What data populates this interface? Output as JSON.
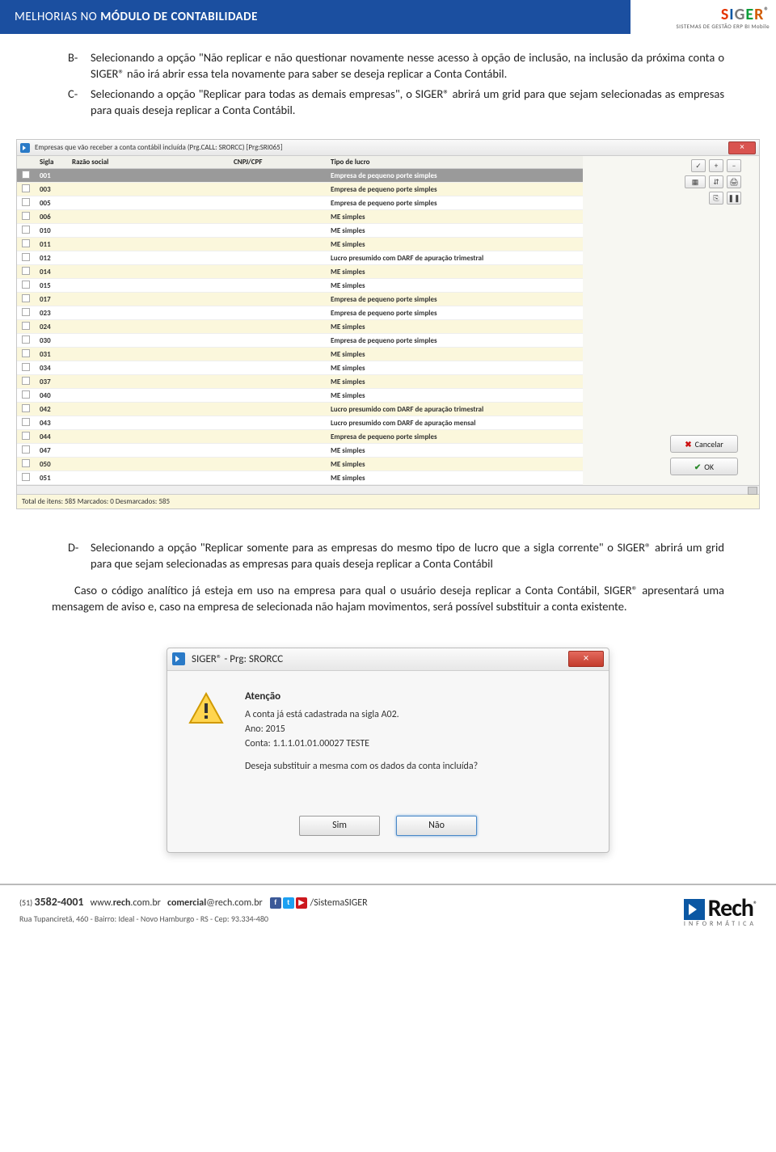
{
  "header": {
    "title_prefix": "MELHORIAS NO ",
    "title_bold": "MÓDULO DE CONTABILIDADE",
    "logo_letters": [
      "S",
      "I",
      "G",
      "E",
      "R"
    ],
    "logo_reg": "®",
    "logo_sub": "SISTEMAS DE GESTÃO ERP BI Mobile"
  },
  "list_b": {
    "letter": "B-",
    "text": "Selecionando a opção \"Não replicar e não questionar novamente nesse acesso à opção de inclusão, na inclusão da próxima conta o SIGER® não irá abrir essa tela novamente para saber se deseja replicar a Conta Contábil."
  },
  "list_c": {
    "letter": "C-",
    "text": "Selecionando a opção \"Replicar para todas as demais empresas\", o SIGER® abrirá um grid para que sejam selecionadas as empresas para quais deseja replicar a Conta Contábil."
  },
  "grid": {
    "title": "Empresas que vão receber a conta contábil incluída (Prg.CALL: SRORCC) [Prg:SRI065]",
    "close_x": "×",
    "cols": {
      "sigla": "Sigla",
      "razao": "Razão social",
      "cnpj": "CNPJ/CPF",
      "tipo": "Tipo de lucro"
    },
    "rows": [
      {
        "sigla": "001",
        "tipo": "Empresa de pequeno porte simples",
        "sel": true
      },
      {
        "sigla": "003",
        "tipo": "Empresa de pequeno porte simples"
      },
      {
        "sigla": "005",
        "tipo": "Empresa de pequeno porte simples"
      },
      {
        "sigla": "006",
        "tipo": "ME simples"
      },
      {
        "sigla": "010",
        "tipo": "ME simples"
      },
      {
        "sigla": "011",
        "tipo": "ME simples"
      },
      {
        "sigla": "012",
        "tipo": "Lucro presumido com DARF de apuração trimestral"
      },
      {
        "sigla": "014",
        "tipo": "ME simples"
      },
      {
        "sigla": "015",
        "tipo": "ME simples"
      },
      {
        "sigla": "017",
        "tipo": "Empresa de pequeno porte simples"
      },
      {
        "sigla": "023",
        "tipo": "Empresa de pequeno porte simples"
      },
      {
        "sigla": "024",
        "tipo": "ME simples"
      },
      {
        "sigla": "030",
        "tipo": "Empresa de pequeno porte simples"
      },
      {
        "sigla": "031",
        "tipo": "ME simples"
      },
      {
        "sigla": "034",
        "tipo": "ME simples"
      },
      {
        "sigla": "037",
        "tipo": "ME simples"
      },
      {
        "sigla": "040",
        "tipo": "ME simples"
      },
      {
        "sigla": "042",
        "tipo": "Lucro presumido com DARF de apuração trimestral"
      },
      {
        "sigla": "043",
        "tipo": "Lucro presumido com DARF de apuração mensal"
      },
      {
        "sigla": "044",
        "tipo": "Empresa de pequeno porte simples"
      },
      {
        "sigla": "047",
        "tipo": "ME simples"
      },
      {
        "sigla": "050",
        "tipo": "ME simples"
      },
      {
        "sigla": "051",
        "tipo": "ME simples"
      }
    ],
    "side": {
      "check": "✓",
      "plus": "+",
      "minus": "−",
      "grid": "▦",
      "flip": "⇵",
      "print": "🖨",
      "export": "⎘",
      "pause": "❚❚"
    },
    "cancel": "Cancelar",
    "ok": "OK",
    "footer": "Total de itens: 585 Marcados: 0 Desmarcados: 585"
  },
  "list_d": {
    "letter": "D-",
    "text": "Selecionando a opção \"Replicar somente para as empresas do mesmo tipo de lucro que a sigla corrente\" o SIGER® abrirá um grid para que sejam selecionadas as empresas para quais deseja replicar a Conta Contábil"
  },
  "para": "Caso o código analítico já esteja em uso na empresa para qual o usuário deseja replicar a Conta Contábil, SIGER® apresentará uma mensagem de aviso e, caso na empresa de selecionada não hajam movimentos, será possível substituir a conta existente.",
  "dialog": {
    "title": "SIGER® - Prg: SRORCC",
    "close_x": "×",
    "heading": "Atenção",
    "line1": "A conta já está cadastrada na sigla A02.",
    "line2": "Ano: 2015",
    "line3": "Conta: 1.1.1.01.01.00027 TESTE",
    "question": "Deseja substituir a mesma com os dados da conta incluída?",
    "sim": "Sim",
    "nao": "Não"
  },
  "footer": {
    "phone_area": "(51) ",
    "phone": "3582-4001",
    "www_pre": "www.",
    "www_b": "rech",
    "www_suf": ".com.br",
    "com_b": "comercial",
    "com_suf": "@rech.com.br",
    "social": "/SistemaSIGER",
    "address": "Rua Tupanciretã, 460 - Bairro: Ideal - Novo Hamburgo - RS - Cep: 93.334-480",
    "brand": "Rech",
    "brand_sub": "INFORMÁTICA",
    "reg": "®"
  }
}
